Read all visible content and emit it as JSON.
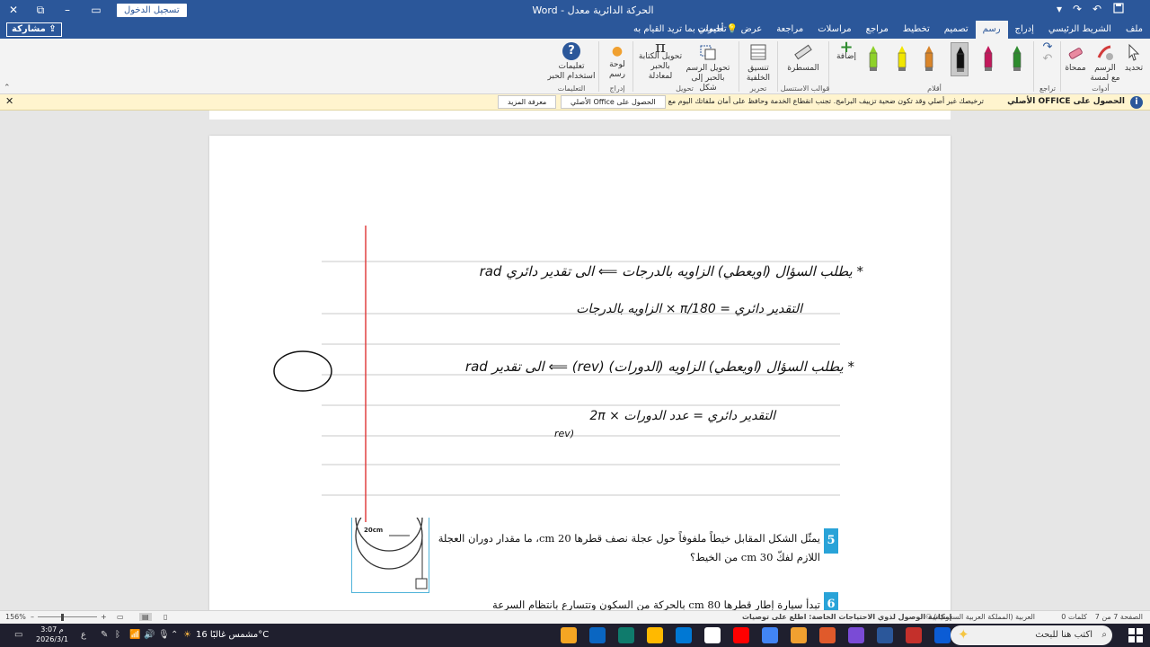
{
  "titlebar": {
    "title": "الحركة الدائرية معدل  -  Word",
    "signin": "تسجيل الدخول",
    "close": "✕",
    "minimize": "–",
    "maximize": "▭",
    "restore": "⧉"
  },
  "tabrow": {
    "share": "مشاركة",
    "tellme": "أخبرني بما تريد القيام به",
    "tabs": [
      "ملف",
      "الشريط الرئيسي",
      "إدراج",
      "رسم",
      "تصميم",
      "تخطيط",
      "مراجع",
      "مراسلات",
      "مراجعة",
      "عرض",
      "تعليمات"
    ],
    "active_tab": "رسم"
  },
  "ribbon": {
    "select": "تحديد",
    "draw_touch": "الرسم مع لمسة",
    "eraser": "ممحاة",
    "group_tools": "أدوات",
    "group_undo": "تراجع",
    "group_pens": "أقلام",
    "add": "إضافة",
    "ruler": "المسطرة",
    "group_stencils": "قوالب الاستنسل",
    "format_bg": "تنسيق الخلفية",
    "group_edit": "تحرير",
    "ink_to_shape": "تحويل الرسم بالحبر إلى شكل",
    "ink_to_math": "تحويل الكتابة بالحبر لمعادلة",
    "group_convert": "تحويل",
    "drawing_canvas": "لوحة رسم",
    "group_insert": "إدراج",
    "ink_help": "تعليمات استخدام الحبر",
    "group_help": "التعليمات",
    "pen_colors": [
      "#2e8b2e",
      "#c2185b",
      "#111111",
      "#d9852a",
      "#f2e600",
      "#8ed12a"
    ]
  },
  "infobar": {
    "title": "الحصول على OFFICE الأصلي",
    "message": "ترخيصك غير أصلي وقد تكون ضحية تزييف البرامج. تجنب انقطاع الخدمة وحافظ على أمان ملفاتك اليوم مع Office الأصلي.",
    "get_genuine": "الحصول على Office الأصلي",
    "learn_more": "معرفة المزيد"
  },
  "document": {
    "hw_line1": "* يطلب السؤال (اويعطي) الزاويه بالدرجات ⟸ الى تقدير دائري rad",
    "hw_line2": "التقدير دائري = π/180 × الزاويه بالدرجات",
    "hw_line3": "* يطلب السؤال (اويعطي) الزاويه (الدورات) (rev) ⟸ الى تقدير rad",
    "hw_line4": "التقدير دائري = عدد الدورات × 2π",
    "hw_line4b": "(rev",
    "q5_number": "5",
    "q5_text_line1": "يمثّل الشكل المقابل خيطاً ملفوفاً حول عجلة نصف قطرها 20 cm، ما مقدار دوران العجلة",
    "q5_text_line2": "اللازم لفكّ 30 cm من الخيط؟",
    "fig_label": "20cm",
    "q6_number": "6",
    "q6_partial": "تبدأ سيارة إطار قطرها 80 cm بالحركة من السكون وتتسارع بانتظام السرعة"
  },
  "statusbar": {
    "page": "الصفحة 7 من 7",
    "words": "0 كلمات",
    "language": "العربية (المملكة العربية السعودية)",
    "accessibility": "إمكانية الوصول لذوي الاحتياجات الخاصة: اطلع على توصيات",
    "zoom": "156%"
  },
  "taskbar": {
    "search_placeholder": "اكتب هنا للبحث",
    "time": "3:07 م",
    "date": "2026/3/1",
    "weather": "مشمس غالبًا  16°C",
    "lang": "ع",
    "app_colors": [
      "#0b5cd5",
      "#c4302b",
      "#2b579a",
      "#7a4bd6",
      "#e05a2b",
      "#f0a030",
      "#4285f4",
      "#ff0000",
      "#ffffff",
      "#0078d4",
      "#ffb900",
      "#0f7b6c",
      "#0a66c2",
      "#f5a623"
    ]
  }
}
